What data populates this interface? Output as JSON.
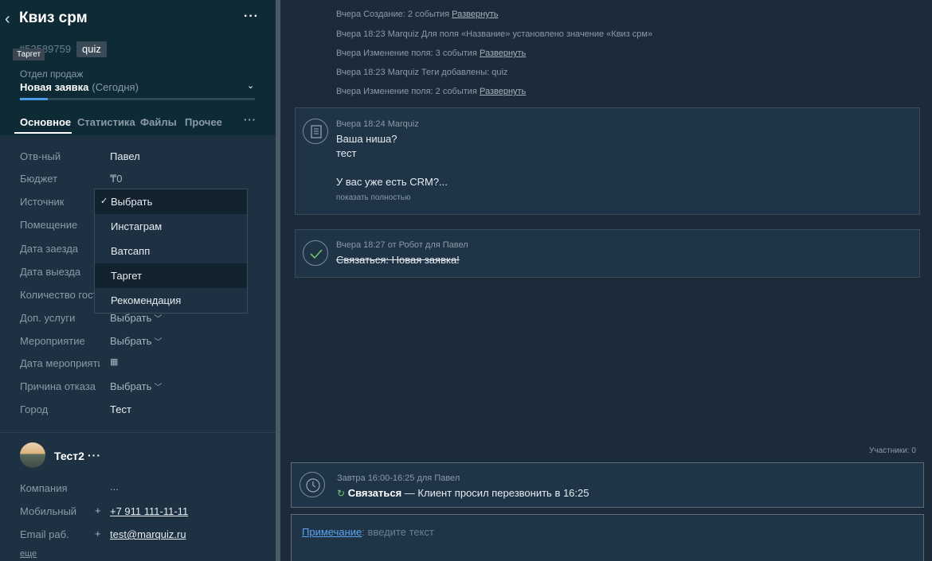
{
  "lead": {
    "title": "Квиз срм",
    "id": "#53589759",
    "tag": "quiz",
    "tooltip": "Таргет",
    "pipeline": "Отдел продаж",
    "stage": "Новая заявка",
    "stage_date": "(Сегодня)",
    "progress_fraction": 0.12
  },
  "tabs": [
    "Основное",
    "Статистика",
    "Файлы",
    "Прочее"
  ],
  "fields": [
    {
      "label": "Отв-ный",
      "value": "Павел"
    },
    {
      "label": "Бюджет",
      "value": "₸0"
    },
    {
      "label": "Источник",
      "value": ""
    },
    {
      "label": "Помещение",
      "value": ""
    },
    {
      "label": "Дата заезда",
      "value": ""
    },
    {
      "label": "Дата выезда",
      "value": ""
    },
    {
      "label": "Количество гостей",
      "value": ""
    },
    {
      "label": "Доп. услуги",
      "value": "Выбрать"
    },
    {
      "label": "Мероприятие",
      "value": "Выбрать"
    },
    {
      "label": "Дата мероприятия",
      "value": ""
    },
    {
      "label": "Причина отказа",
      "value": "Выбрать"
    },
    {
      "label": "Город",
      "value": "Тест"
    }
  ],
  "dropdown": {
    "options": [
      "Выбрать",
      "Инстаграм",
      "Ватсапп",
      "Таргет",
      "Рекомендация"
    ],
    "selected": "Выбрать",
    "hovered": "Таргет"
  },
  "contact": {
    "name": "Тест2",
    "company_label": "Компания",
    "company_value": "...",
    "phone_label": "Мобильный",
    "phone": "+7 911 111-11-11",
    "email_label": "Email раб.",
    "email": "test@marquiz.ru",
    "more": "еще"
  },
  "feed": {
    "events": [
      {
        "text": "Вчера Создание: 2 события",
        "link": "Развернуть"
      },
      {
        "text": "Вчера 18:23 Marquiz Для поля «Название» установлено значение «Квиз срм»",
        "link": ""
      },
      {
        "text": "Вчера Изменение поля: 3 события",
        "link": "Развернуть"
      },
      {
        "text": "Вчера 18:23 Marquiz Теги добавлены: quiz",
        "link": ""
      },
      {
        "text": "Вчера Изменение поля: 2 события",
        "link": "Развернуть"
      }
    ],
    "note_card": {
      "meta": "Вчера 18:24 Marquiz",
      "line1": "Ваша ниша?",
      "line2": "тест",
      "line3": "У вас уже есть CRM?...",
      "more": "показать полностью"
    },
    "robot_card": {
      "meta": "Вчера 18:27  от Робот для Павел",
      "text": "Связаться: Новая заявка!"
    },
    "participants": "Участники: 0",
    "task": {
      "meta": "Завтра 16:00-16:25 для Павел",
      "type": "Связаться",
      "text": " — Клиент просил перезвонить в 16:25"
    },
    "note_input": {
      "link": "Примечание",
      "placeholder": ": введите текст"
    }
  },
  "colors": {
    "accent_blue": "#5aa3f0",
    "success_green": "#6ec46e",
    "header_bg": "#0d2a35",
    "panel_bg": "#1d3142"
  }
}
